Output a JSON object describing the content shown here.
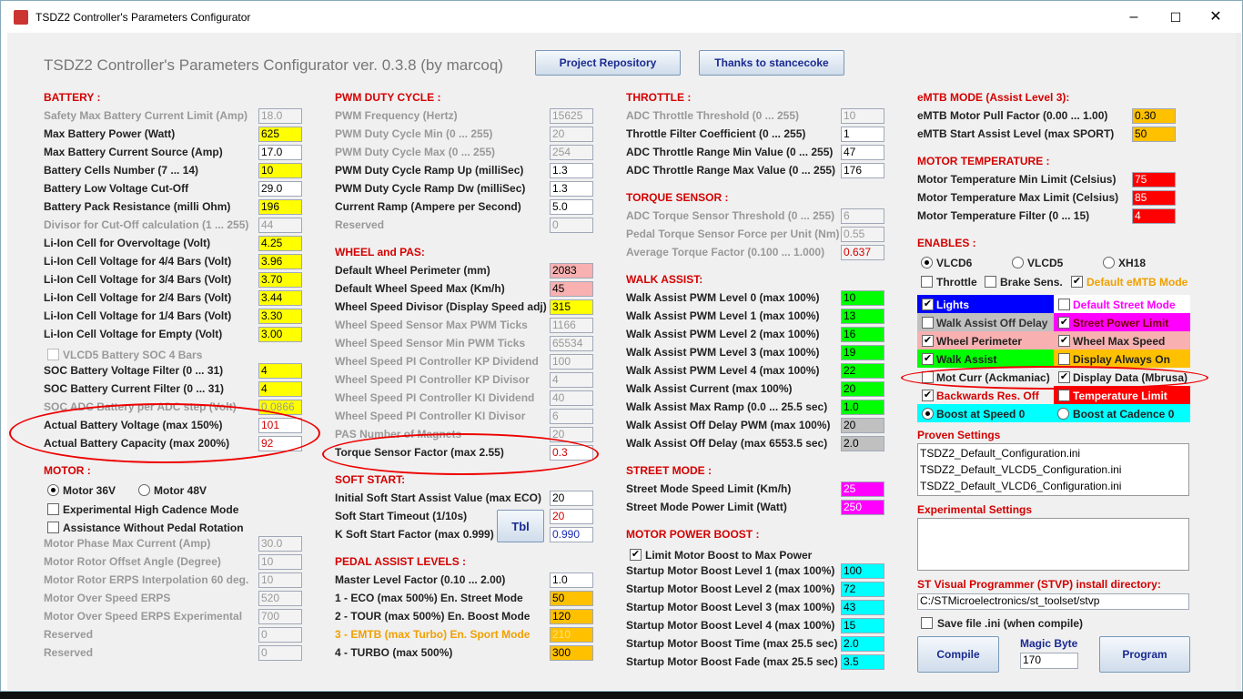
{
  "window": {
    "title": "TSDZ2 Controller's Parameters Configurator",
    "min": "–",
    "max": "☐",
    "close": "✕"
  },
  "header": {
    "title": "TSDZ2 Controller's Parameters Configurator ver. 0.3.8 (by marcoq)",
    "project_button": "Project Repository",
    "thanks_button": "Thanks to stancecoke"
  },
  "colors": {
    "section": "#d40000",
    "yellow": "#ffff00",
    "orange": "#ffc000",
    "red": "#ff0000",
    "green": "#00ff00",
    "cyan": "#00ffff",
    "pink": "#f8b0b0",
    "magenta": "#ff00ff",
    "gray": "#c0c0c0"
  },
  "battery": {
    "title": "BATTERY :",
    "rows": [
      {
        "label": "Safety Max Battery Current Limit (Amp)",
        "value": "18.0",
        "disabled": true,
        "color": ""
      },
      {
        "label": "Max Battery Power (Watt)",
        "value": "625",
        "disabled": false,
        "color": "#ffff00"
      },
      {
        "label": "Max Battery Current Source (Amp)",
        "value": "17.0",
        "disabled": false,
        "color": ""
      },
      {
        "label": "Battery Cells Number (7 ... 14)",
        "value": "10",
        "disabled": false,
        "color": "#ffff00"
      },
      {
        "label": "Battery Low Voltage Cut-Off",
        "value": "29.0",
        "disabled": false,
        "color": ""
      },
      {
        "label": "Battery Pack Resistance (milli Ohm)",
        "value": "196",
        "disabled": false,
        "color": "#ffff00"
      },
      {
        "label": "Divisor for Cut-Off calculation (1 ... 255)",
        "value": "44",
        "disabled": true,
        "color": ""
      },
      {
        "label": "Li-Ion Cell for Overvoltage (Volt)",
        "value": "4.25",
        "disabled": false,
        "color": "#ffff00"
      },
      {
        "label": "Li-Ion Cell Voltage for 4/4 Bars (Volt)",
        "value": "3.96",
        "disabled": false,
        "color": "#ffff00"
      },
      {
        "label": "Li-Ion Cell Voltage for 3/4 Bars (Volt)",
        "value": "3.70",
        "disabled": false,
        "color": "#ffff00"
      },
      {
        "label": "Li-Ion Cell Voltage for 2/4 Bars (Volt)",
        "value": "3.44",
        "disabled": false,
        "color": "#ffff00"
      },
      {
        "label": "Li-Ion Cell Voltage for 1/4 Bars (Volt)",
        "value": "3.30",
        "disabled": false,
        "color": "#ffff00"
      },
      {
        "label": "Li-Ion Cell Voltage for Empty (Volt)",
        "value": "3.00",
        "disabled": false,
        "color": "#ffff00"
      }
    ],
    "vlcd5_soc": "VLCD5 Battery SOC 4 Bars",
    "rows2": [
      {
        "label": "SOC Battery Voltage Filter (0 ... 31)",
        "value": "4",
        "disabled": false,
        "color": "#ffff00"
      },
      {
        "label": "SOC Battery Current Filter (0 ... 31)",
        "value": "4",
        "disabled": false,
        "color": "#ffff00"
      },
      {
        "label": "SOC ADC Battery per ADC step (Volt)",
        "value": "0.0866",
        "disabled": true,
        "color": "#ffff00"
      },
      {
        "label": "Actual Battery Voltage (max 150%)",
        "value": "101",
        "disabled": false,
        "color": ""
      },
      {
        "label": "Actual Battery Capacity (max 200%)",
        "value": "92",
        "disabled": false,
        "color": ""
      }
    ]
  },
  "motor": {
    "title": "MOTOR :",
    "motor36": "Motor 36V",
    "motor48": "Motor 48V",
    "exp_cadence": "Experimental High Cadence Mode",
    "assist_no_pedal": "Assistance Without Pedal Rotation",
    "rows": [
      {
        "label": "Motor Phase Max Current (Amp)",
        "value": "30.0"
      },
      {
        "label": "Motor Rotor Offset Angle (Degree)",
        "value": "10"
      },
      {
        "label": "Motor Rotor ERPS Interpolation 60 deg.",
        "value": "10"
      },
      {
        "label": "Motor Over Speed ERPS",
        "value": "520"
      },
      {
        "label": "Motor Over Speed ERPS Experimental",
        "value": "700"
      },
      {
        "label": "Reserved",
        "value": "0"
      },
      {
        "label": "Reserved",
        "value": "0"
      }
    ]
  },
  "pwm": {
    "title": "PWM DUTY CYCLE :",
    "rows": [
      {
        "label": "PWM Frequency (Hertz)",
        "value": "15625",
        "disabled": true
      },
      {
        "label": "PWM Duty Cycle Min (0 ... 255)",
        "value": "20",
        "disabled": true
      },
      {
        "label": "PWM Duty Cycle Max (0 ... 255)",
        "value": "254",
        "disabled": true
      },
      {
        "label": "PWM Duty Cycle Ramp Up (milliSec)",
        "value": "1.3",
        "disabled": false
      },
      {
        "label": "PWM Duty Cycle Ramp Dw (milliSec)",
        "value": "1.3",
        "disabled": false
      },
      {
        "label": "Current Ramp (Ampere per Second)",
        "value": "5.0",
        "disabled": false
      },
      {
        "label": "Reserved",
        "value": "0",
        "disabled": true
      }
    ]
  },
  "wheel": {
    "title": "WHEEL and PAS:",
    "rows": [
      {
        "label": "Default Wheel Perimeter (mm)",
        "value": "2083",
        "disabled": false,
        "color": "#f8b0b0"
      },
      {
        "label": "Default Wheel Speed Max (Km/h)",
        "value": "45",
        "disabled": false,
        "color": "#f8b0b0"
      },
      {
        "label": "Wheel Speed Divisor (Display Speed adj)",
        "value": "315",
        "disabled": false,
        "color": "#ffff00"
      },
      {
        "label": "Wheel Speed Sensor Max PWM Ticks",
        "value": "1166",
        "disabled": true,
        "color": ""
      },
      {
        "label": "Wheel Speed Sensor Min PWM Ticks",
        "value": "65534",
        "disabled": true,
        "color": ""
      },
      {
        "label": "Wheel Speed PI Controller KP Dividend",
        "value": "100",
        "disabled": true,
        "color": ""
      },
      {
        "label": "Wheel Speed PI Controller KP Divisor",
        "value": "4",
        "disabled": true,
        "color": ""
      },
      {
        "label": "Wheel Speed PI Controller KI Dividend",
        "value": "40",
        "disabled": true,
        "color": ""
      },
      {
        "label": "Wheel Speed PI Controller KI Divisor",
        "value": "6",
        "disabled": true,
        "color": ""
      },
      {
        "label": "PAS Number of Magnets",
        "value": "20",
        "disabled": true,
        "color": ""
      },
      {
        "label": "Torque Sensor Factor (max 2.55)",
        "value": "0.3",
        "disabled": false,
        "color": ""
      }
    ]
  },
  "soft_start": {
    "title": "SOFT START:",
    "rows": [
      {
        "label": "Initial Soft Start Assist Value (max ECO)",
        "value": "20",
        "color": ""
      },
      {
        "label": "Soft Start Timeout (1/10s)",
        "value": "20",
        "color": "red-text"
      },
      {
        "label": "K Soft Start Factor (max 0.999)",
        "value": "0.990",
        "color": "blue-text"
      }
    ],
    "tbl_button": "Tbl"
  },
  "pedal_assist": {
    "title": "PEDAL ASSIST LEVELS :",
    "rows": [
      {
        "label": "Master Level Factor (0.10 ... 2.00)",
        "value": "1.0",
        "color": ""
      },
      {
        "label": "1 - ECO    (max 500%) En. Street Mode",
        "value": "50",
        "color": "#ffc000"
      },
      {
        "label": "2 - TOUR  (max 500%) En. Boost Mode",
        "value": "120",
        "color": "#ffc000"
      },
      {
        "label": "3 - EMTB  (max Turbo) En. Sport Mode",
        "value": "210",
        "color": "#ffc000"
      },
      {
        "label": "4 - TURBO (max 500%)",
        "value": "300",
        "color": "#ffc000"
      }
    ]
  },
  "throttle": {
    "title": "THROTTLE :",
    "rows": [
      {
        "label": "ADC Throttle Threshold (0 ... 255)",
        "value": "10",
        "disabled": true
      },
      {
        "label": "Throttle Filter Coefficient (0 ... 255)",
        "value": "1",
        "disabled": false
      },
      {
        "label": "ADC Throttle Range Min Value (0 ... 255)",
        "value": "47",
        "disabled": false
      },
      {
        "label": "ADC Throttle Range Max Value (0 ... 255)",
        "value": "176",
        "disabled": false
      }
    ]
  },
  "torque": {
    "title": "TORQUE SENSOR :",
    "rows": [
      {
        "label": "ADC Torque Sensor Threshold (0 ... 255)",
        "value": "6"
      },
      {
        "label": "Pedal Torque Sensor Force per Unit (Nm)",
        "value": "0.55"
      },
      {
        "label": "Average Torque Factor (0.100 ... 1.000)",
        "value": "0.637"
      }
    ]
  },
  "walk_assist": {
    "title": "WALK ASSIST:",
    "rows": [
      {
        "label": "Walk Assist PWM Level 0 (max 100%)",
        "value": "10",
        "color": "#00ff00"
      },
      {
        "label": "Walk Assist PWM Level 1 (max 100%)",
        "value": "13",
        "color": "#00ff00"
      },
      {
        "label": "Walk Assist PWM Level 2 (max 100%)",
        "value": "16",
        "color": "#00ff00"
      },
      {
        "label": "Walk Assist PWM Level 3 (max 100%)",
        "value": "19",
        "color": "#00ff00"
      },
      {
        "label": "Walk Assist PWM Level 4 (max 100%)",
        "value": "22",
        "color": "#00ff00"
      },
      {
        "label": "Walk Assist Current (max 100%)",
        "value": "20",
        "color": "#00ff00"
      },
      {
        "label": "Walk Assist Max Ramp (0.0 ... 25.5 sec)",
        "value": "1.0",
        "color": "#00ff00"
      },
      {
        "label": "Walk Assist Off Delay PWM (max 100%)",
        "value": "20",
        "color": "#c0c0c0"
      },
      {
        "label": "Walk Assist Off Delay (max 6553.5 sec)",
        "value": "2.0",
        "color": "#c0c0c0"
      }
    ]
  },
  "street_mode": {
    "title": "STREET MODE :",
    "rows": [
      {
        "label": "Street Mode Speed Limit (Km/h)",
        "value": "25",
        "color": "#ff00ff"
      },
      {
        "label": "Street Mode Power Limit (Watt)",
        "value": "250",
        "color": "#ff00ff"
      }
    ]
  },
  "boost": {
    "title": "MOTOR POWER BOOST :",
    "limit_to_max": "Limit Motor Boost to Max Power",
    "rows": [
      {
        "label": "Startup Motor Boost Level 1 (max 100%)",
        "value": "100"
      },
      {
        "label": "Startup Motor Boost Level 2 (max 100%)",
        "value": "72"
      },
      {
        "label": "Startup Motor Boost Level 3 (max 100%)",
        "value": "43"
      },
      {
        "label": "Startup Motor Boost Level 4 (max 100%)",
        "value": "15"
      },
      {
        "label": "Startup Motor Boost Time (max 25.5 sec)",
        "value": "2.0"
      },
      {
        "label": "Startup Motor Boost Fade (max 25.5 sec)",
        "value": "3.5"
      }
    ]
  },
  "emtb": {
    "title": "eMTB MODE (Assist Level 3):",
    "rows": [
      {
        "label": "eMTB Motor Pull Factor (0.00 ... 1.00)",
        "value": "0.30"
      },
      {
        "label": "eMTB Start Assist Level (max SPORT)",
        "value": "50"
      }
    ]
  },
  "motor_temp": {
    "title": "MOTOR TEMPERATURE :",
    "rows": [
      {
        "label": "Motor Temperature Min Limit (Celsius)",
        "value": "75"
      },
      {
        "label": "Motor Temperature Max Limit (Celsius)",
        "value": "85"
      },
      {
        "label": "Motor Temperature Filter (0 ... 15)",
        "value": "4"
      }
    ]
  },
  "enables": {
    "title": "ENABLES :",
    "vlcd6": "VLCD6",
    "vlcd5": "VLCD5",
    "xh18": "XH18",
    "throttle": "Throttle",
    "brake": "Brake Sens.",
    "default_emtb": "Default eMTB Mode",
    "grid": [
      {
        "label": "Lights",
        "checked": true,
        "bg": "#0000ff",
        "fg": "#ffffff"
      },
      {
        "label": "Default Street Mode",
        "checked": false,
        "bg": "#ffffff",
        "fg": "#ff00ff"
      },
      {
        "label": "Walk Assist Off Delay",
        "checked": false,
        "bg": "#c0c0c0",
        "fg": "#333333"
      },
      {
        "label": "Street Power Limit",
        "checked": true,
        "bg": "#ff00ff",
        "fg": "#7a0000"
      },
      {
        "label": "Wheel Perimeter",
        "checked": true,
        "bg": "#f8b0b0",
        "fg": "#222222"
      },
      {
        "label": "Wheel Max Speed",
        "checked": true,
        "bg": "#f8b0b0",
        "fg": "#222222"
      },
      {
        "label": "Walk Assist",
        "checked": true,
        "bg": "#00ff00",
        "fg": "#222222"
      },
      {
        "label": "Display Always On",
        "checked": false,
        "bg": "#ffc000",
        "fg": "#222222"
      },
      {
        "label": "Mot Curr (Ackmaniac)",
        "checked": false,
        "bg": "#f0f0f0",
        "fg": "#222222"
      },
      {
        "label": "Display Data (Mbrusa)",
        "checked": true,
        "bg": "#f0f0f0",
        "fg": "#222222"
      },
      {
        "label": "Backwards Res. Off",
        "checked": true,
        "bg": "#f0f0f0",
        "fg": "#d40000"
      },
      {
        "label": "Temperature Limit",
        "checked": false,
        "bg": "#ff0000",
        "fg": "#ffffff"
      }
    ],
    "boost_speed": "Boost at Speed 0",
    "boost_cadence": "Boost at Cadence 0"
  },
  "proven": {
    "title": "Proven Settings",
    "items": [
      "TSDZ2_Default_Configuration.ini",
      "TSDZ2_Default_VLCD5_Configuration.ini",
      "TSDZ2_Default_VLCD6_Configuration.ini"
    ]
  },
  "experimental": {
    "title": "Experimental Settings"
  },
  "stvp": {
    "title": "ST Visual Programmer (STVP) install directory:",
    "path": "C:/STMicroelectronics/st_toolset/stvp",
    "save_ini": "Save file .ini (when compile)"
  },
  "actions": {
    "compile": "Compile",
    "magic_label": "Magic Byte",
    "magic_value": "170",
    "program": "Program"
  }
}
